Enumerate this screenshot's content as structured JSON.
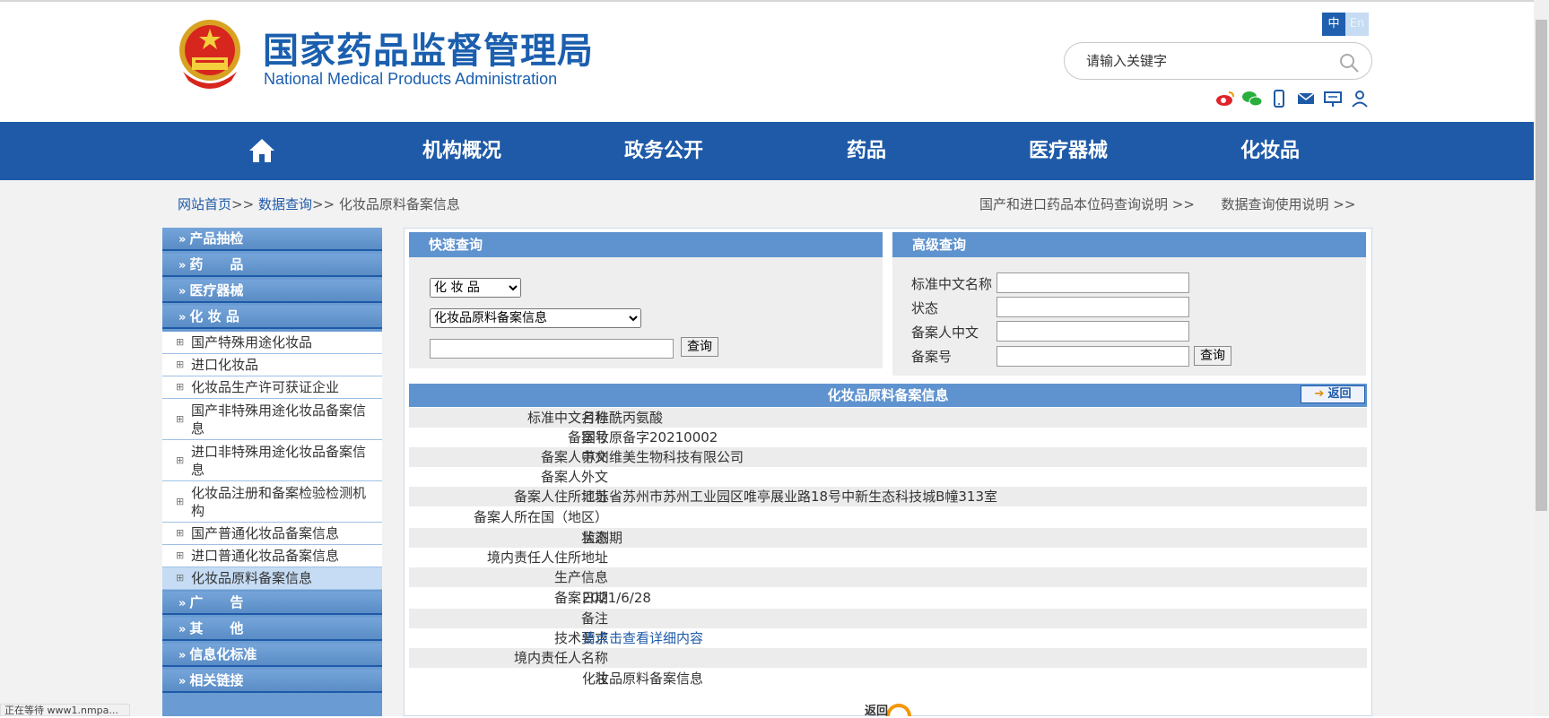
{
  "header": {
    "title_cn": "国家药品监督管理局",
    "title_en": "National Medical Products Administration",
    "lang_zh": "中",
    "lang_en": "En",
    "search_placeholder": "请输入关键字",
    "social_icons": [
      "weibo-icon",
      "wechat-icon",
      "mobile-icon",
      "mail-icon",
      "message-icon",
      "user-icon"
    ]
  },
  "nav": {
    "items": [
      "机构概况",
      "政务公开",
      "药品",
      "医疗器械",
      "化妆品"
    ]
  },
  "breadcrumb": {
    "home": "网站首页",
    "sep": ">>",
    "data_query": "数据查询",
    "current": "化妆品原料备案信息",
    "right_link1": "国产和进口药品本位码查询说明",
    "right_link2": "数据查询使用说明",
    "right_suffix": ">>"
  },
  "sidebar": {
    "categories": [
      "产品抽检",
      "药　　品",
      "医疗器械",
      "化 妆 品",
      "广　　告",
      "其　　他",
      "信息化标准",
      "相关链接"
    ],
    "sub_items": [
      "国产特殊用途化妆品",
      "进口化妆品",
      "化妆品生产许可获证企业",
      "国产非特殊用途化妆品备案信息",
      "进口非特殊用途化妆品备案信息",
      "化妆品注册和备案检验检测机构",
      "国产普通化妆品备案信息",
      "进口普通化妆品备案信息",
      "化妆品原料备案信息"
    ]
  },
  "quick_search": {
    "title": "快速查询",
    "category_selected": "化 妆 品",
    "type_selected": "化妆品原料备案信息",
    "query_button": "查询"
  },
  "advanced_search": {
    "title": "高级查询",
    "labels": [
      "标准中文名称",
      "状态",
      "备案人中文",
      "备案号"
    ],
    "query_button": "查询"
  },
  "detail": {
    "title": "化妆品原料备案信息",
    "return_label": "返回",
    "rows": [
      {
        "label": "标准中文名称",
        "value": "月桂酰丙氨酸"
      },
      {
        "label": "备案号",
        "value": "国妆原备字20210002"
      },
      {
        "label": "备案人中文",
        "value": "苏州维美生物科技有限公司"
      },
      {
        "label": "备案人外文",
        "value": ""
      },
      {
        "label": "备案人住所地址",
        "value": "江苏省苏州市苏州工业园区唯亭展业路18号中新生态科技城B幢313室"
      },
      {
        "label": "备案人所在国（地区）",
        "value": ""
      },
      {
        "label": "状态",
        "value": "监测期"
      },
      {
        "label": "境内责任人住所地址",
        "value": ""
      },
      {
        "label": "生产信息",
        "value": ""
      },
      {
        "label": "备案日期",
        "value": "2021/6/28"
      },
      {
        "label": "备注",
        "value": ""
      },
      {
        "label": "技术要求",
        "value": "请点击查看详细内容"
      },
      {
        "label": "境内责任人名称",
        "value": ""
      },
      {
        "label": "注",
        "value": "化妆品原料备案信息"
      }
    ],
    "bottom_return": "返回"
  },
  "status_bar": "正在等待 www1.nmpa..."
}
